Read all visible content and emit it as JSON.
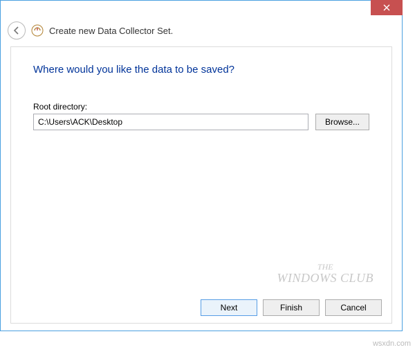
{
  "window": {
    "title": "Create new Data Collector Set."
  },
  "page": {
    "heading": "Where would you like the data to be saved?",
    "root_directory_label": "Root directory:",
    "root_directory_value": "C:\\Users\\ACK\\Desktop",
    "browse_label": "Browse..."
  },
  "buttons": {
    "next": "Next",
    "finish": "Finish",
    "cancel": "Cancel"
  },
  "watermark": {
    "line1": "THE",
    "line2": "WINDOWS CLUB"
  },
  "source": "wsxdn.com"
}
